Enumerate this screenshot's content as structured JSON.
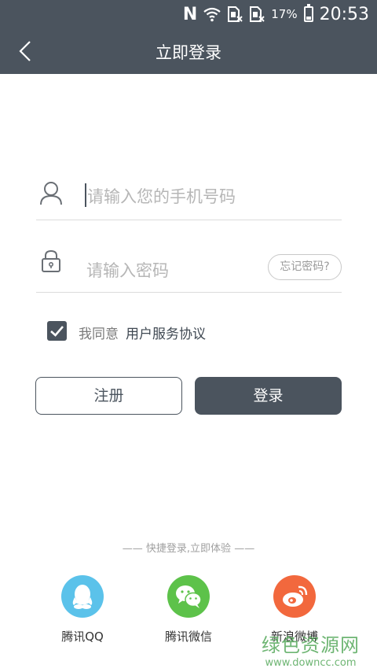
{
  "status_bar": {
    "n_icon": "N",
    "battery": "17%",
    "time": "20:53",
    "icons": [
      "nfc-icon",
      "wifi-icon",
      "sim-1-icon",
      "sim-2-icon",
      "battery-icon"
    ]
  },
  "header": {
    "title": "立即登录"
  },
  "form": {
    "phone_placeholder": "请输入您的手机号码",
    "password_placeholder": "请输入密码",
    "forgot_label": "忘记密码?",
    "agree_label": "我同意",
    "agreement_link": "用户服务协议",
    "agree_checked": true
  },
  "buttons": {
    "register": "注册",
    "login": "登录"
  },
  "quick_login": {
    "caption": "—— 快捷登录,立即体验 ——",
    "providers": [
      {
        "label": "腾讯QQ",
        "color": "#5bc2ea"
      },
      {
        "label": "腾讯微信",
        "color": "#5dc24a"
      },
      {
        "label": "新浪微博",
        "color": "#f2683d"
      }
    ]
  },
  "watermark": {
    "name": "绿色资源网",
    "url": "www.downcc.com"
  },
  "colors": {
    "primary": "#4b545e",
    "qq": "#5bc2ea",
    "wechat": "#5dc24a",
    "weibo": "#f2683d",
    "watermark": "#5fae64"
  }
}
